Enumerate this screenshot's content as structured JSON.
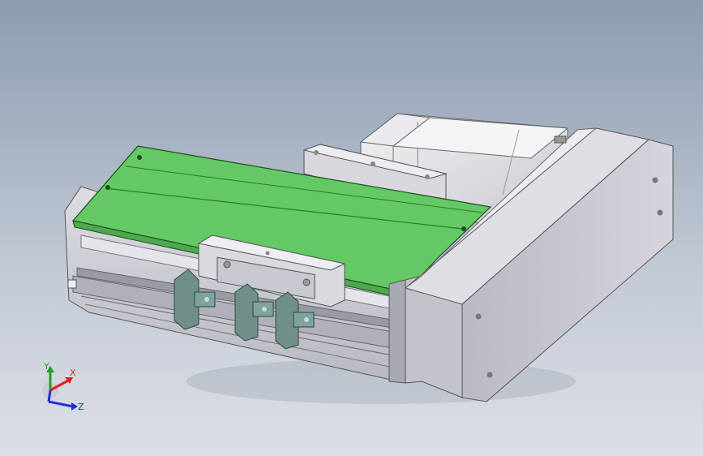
{
  "viewport": {
    "background_top": "#8d9db2",
    "background_bottom": "#dcdfe6"
  },
  "model": {
    "description_colors": {
      "carriage_plate": "#64c864",
      "body": "#c9c9d2",
      "end_cap": "#d8d8e0",
      "motor": "#e6e6ea",
      "sensor": "#6f8f88"
    }
  },
  "triad": {
    "x_label": "X",
    "y_label": "Y",
    "z_label": "Z",
    "x_color": "#e02020",
    "y_color": "#20a020",
    "z_color": "#2030d0"
  }
}
